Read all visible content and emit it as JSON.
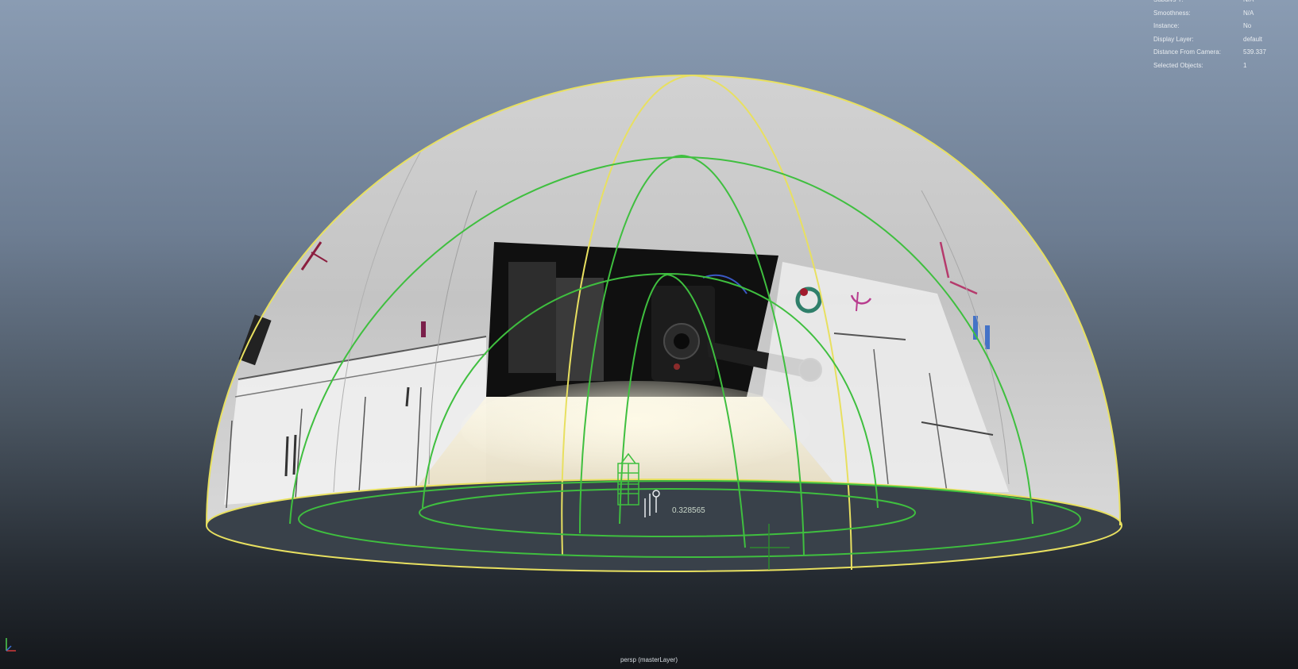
{
  "viewport": {
    "camera_label": "persp (masterLayer)"
  },
  "hud": {
    "rows": [
      {
        "label": "Subdivs Y:",
        "value": "N/A"
      },
      {
        "label": "Smoothness:",
        "value": "N/A"
      },
      {
        "label": "Instance:",
        "value": "No"
      },
      {
        "label": "Display Layer:",
        "value": "default"
      },
      {
        "label": "Distance From Camera:",
        "value": "539.337"
      },
      {
        "label": "Selected Objects:",
        "value": "1"
      }
    ]
  },
  "manipulator": {
    "readout": "0.328565"
  },
  "colors": {
    "selection_wire": "#e8e060",
    "light_wire": "#3fbf3f",
    "dome_surface": "#c7c7c7",
    "ground_disc": "#3a4047"
  }
}
